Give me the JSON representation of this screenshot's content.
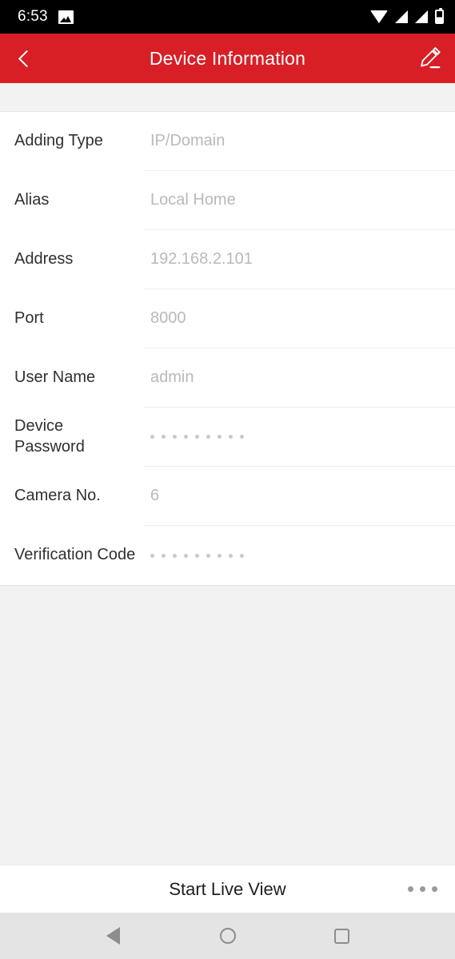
{
  "status_bar": {
    "time": "6:53",
    "icons": [
      "image-icon",
      "wifi-icon",
      "signal-icon",
      "signal-icon",
      "battery-icon"
    ]
  },
  "header": {
    "title": "Device Information",
    "back_icon": "chevron-left-icon",
    "edit_icon": "pencil-edit-icon",
    "background_color": "#d81f26"
  },
  "form": {
    "fields": [
      {
        "label": "Adding Type",
        "value": "IP/Domain",
        "type": "text"
      },
      {
        "label": "Alias",
        "value": "Local Home",
        "type": "text"
      },
      {
        "label": "Address",
        "value": "192.168.2.101",
        "type": "text"
      },
      {
        "label": "Port",
        "value": "8000",
        "type": "text"
      },
      {
        "label": "User Name",
        "value": "admin",
        "type": "text"
      },
      {
        "label": "Device Password",
        "value": "•••••••••",
        "type": "password",
        "dot_count": 9
      },
      {
        "label": "Camera No.",
        "value": "6",
        "type": "text"
      },
      {
        "label": "Verification Code",
        "value": "•••••••••",
        "type": "password",
        "dot_count": 9
      }
    ]
  },
  "bottom_bar": {
    "action_label": "Start Live View",
    "more_icon": "overflow-dots-icon"
  },
  "nav_bar": {
    "back_icon": "triangle-back-icon",
    "home_icon": "circle-home-icon",
    "recents_icon": "square-recents-icon"
  },
  "colors": {
    "brand_red": "#d81f26",
    "page_bg": "#f2f2f2",
    "label_text": "#303030",
    "value_text": "#b9b9b9"
  }
}
